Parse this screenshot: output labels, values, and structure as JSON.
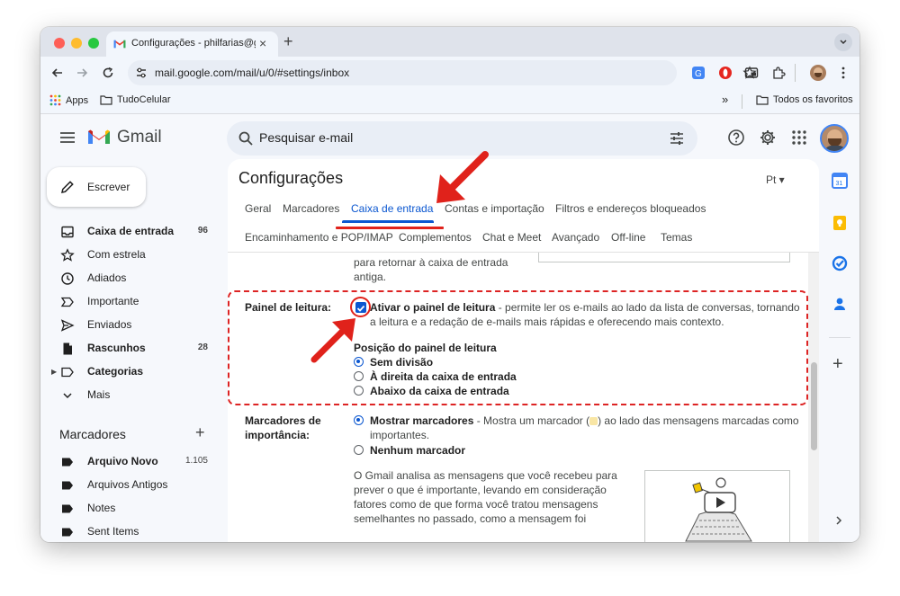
{
  "browser": {
    "tab_title": "Configurações - philfarias@gmail.com",
    "new_tab_symbol": "+",
    "url": "mail.google.com/mail/u/0/#settings/inbox",
    "bookmarks": {
      "apps": "Apps",
      "folder": "TudoCelular",
      "overflow": "»",
      "all_bookmarks": "Todos os favoritos"
    }
  },
  "gmail": {
    "wordmark": "Gmail",
    "search_placeholder": "Pesquisar e-mail",
    "compose_label": "Escrever",
    "nav": [
      {
        "label": "Caixa de entrada",
        "count": "96",
        "bold": true
      },
      {
        "label": "Com estrela",
        "count": "",
        "bold": false
      },
      {
        "label": "Adiados",
        "count": "",
        "bold": false
      },
      {
        "label": "Importante",
        "count": "",
        "bold": false
      },
      {
        "label": "Enviados",
        "count": "",
        "bold": false
      },
      {
        "label": "Rascunhos",
        "count": "28",
        "bold": true
      },
      {
        "label": "Categorias",
        "count": "",
        "bold": true
      },
      {
        "label": "Mais",
        "count": "",
        "bold": false
      }
    ],
    "labels_title": "Marcadores",
    "labels": [
      {
        "label": "Arquivo Novo",
        "count": "1.105",
        "bold": true
      },
      {
        "label": "Arquivos Antigos",
        "count": "",
        "bold": false
      },
      {
        "label": "Notes",
        "count": "",
        "bold": false
      },
      {
        "label": "Sent Items",
        "count": "",
        "bold": false
      }
    ]
  },
  "settings": {
    "title": "Configurações",
    "input_tools": "Pt ▾",
    "tabs_row1": [
      "Geral",
      "Marcadores",
      "Caixa de entrada",
      "Contas e importação",
      "Filtros e endereços bloqueados"
    ],
    "tabs_row2": [
      "Encaminhamento e POP/IMAP",
      "Complementos",
      "Chat e Meet",
      "Avançado",
      "Off-line",
      "Temas"
    ],
    "active_tab": "Caixa de entrada",
    "prev_text_line1": "para retornar à caixa de entrada",
    "prev_text_line2": "antiga.",
    "reading_pane": {
      "label": "Painel de leitura:",
      "checkbox_label": "Ativar o painel de leitura",
      "checkbox_desc_line1": " - permite ler os e-mails ao lado da lista de conversas, tornando",
      "checkbox_desc_line2": "a leitura e a redação de e-mails mais rápidas e oferecendo mais contexto.",
      "checked": true,
      "position_title": "Posição do painel de leitura",
      "options": [
        "Sem divisão",
        "À direita da caixa de entrada",
        "Abaixo da caixa de entrada"
      ],
      "selected": 0
    },
    "importance": {
      "label_line1": "Marcadores de",
      "label_line2": "importância:",
      "show_label": "Mostrar marcadores",
      "show_desc_a": " - Mostra um marcador (",
      "show_desc_b": ") ao lado das mensagens marcadas como",
      "show_desc_line2": "importantes.",
      "none_label": "Nenhum marcador",
      "selected": 0,
      "info_lines": [
        "O Gmail analisa as mensagens que você recebeu para",
        "prever o que é importante, levando em consideração",
        "fatores como de que forma você tratou mensagens",
        "semelhantes no passado, como a mensagem foi"
      ]
    }
  },
  "colors": {
    "accent": "#0b57d0",
    "annotation_red": "#e0221b"
  }
}
